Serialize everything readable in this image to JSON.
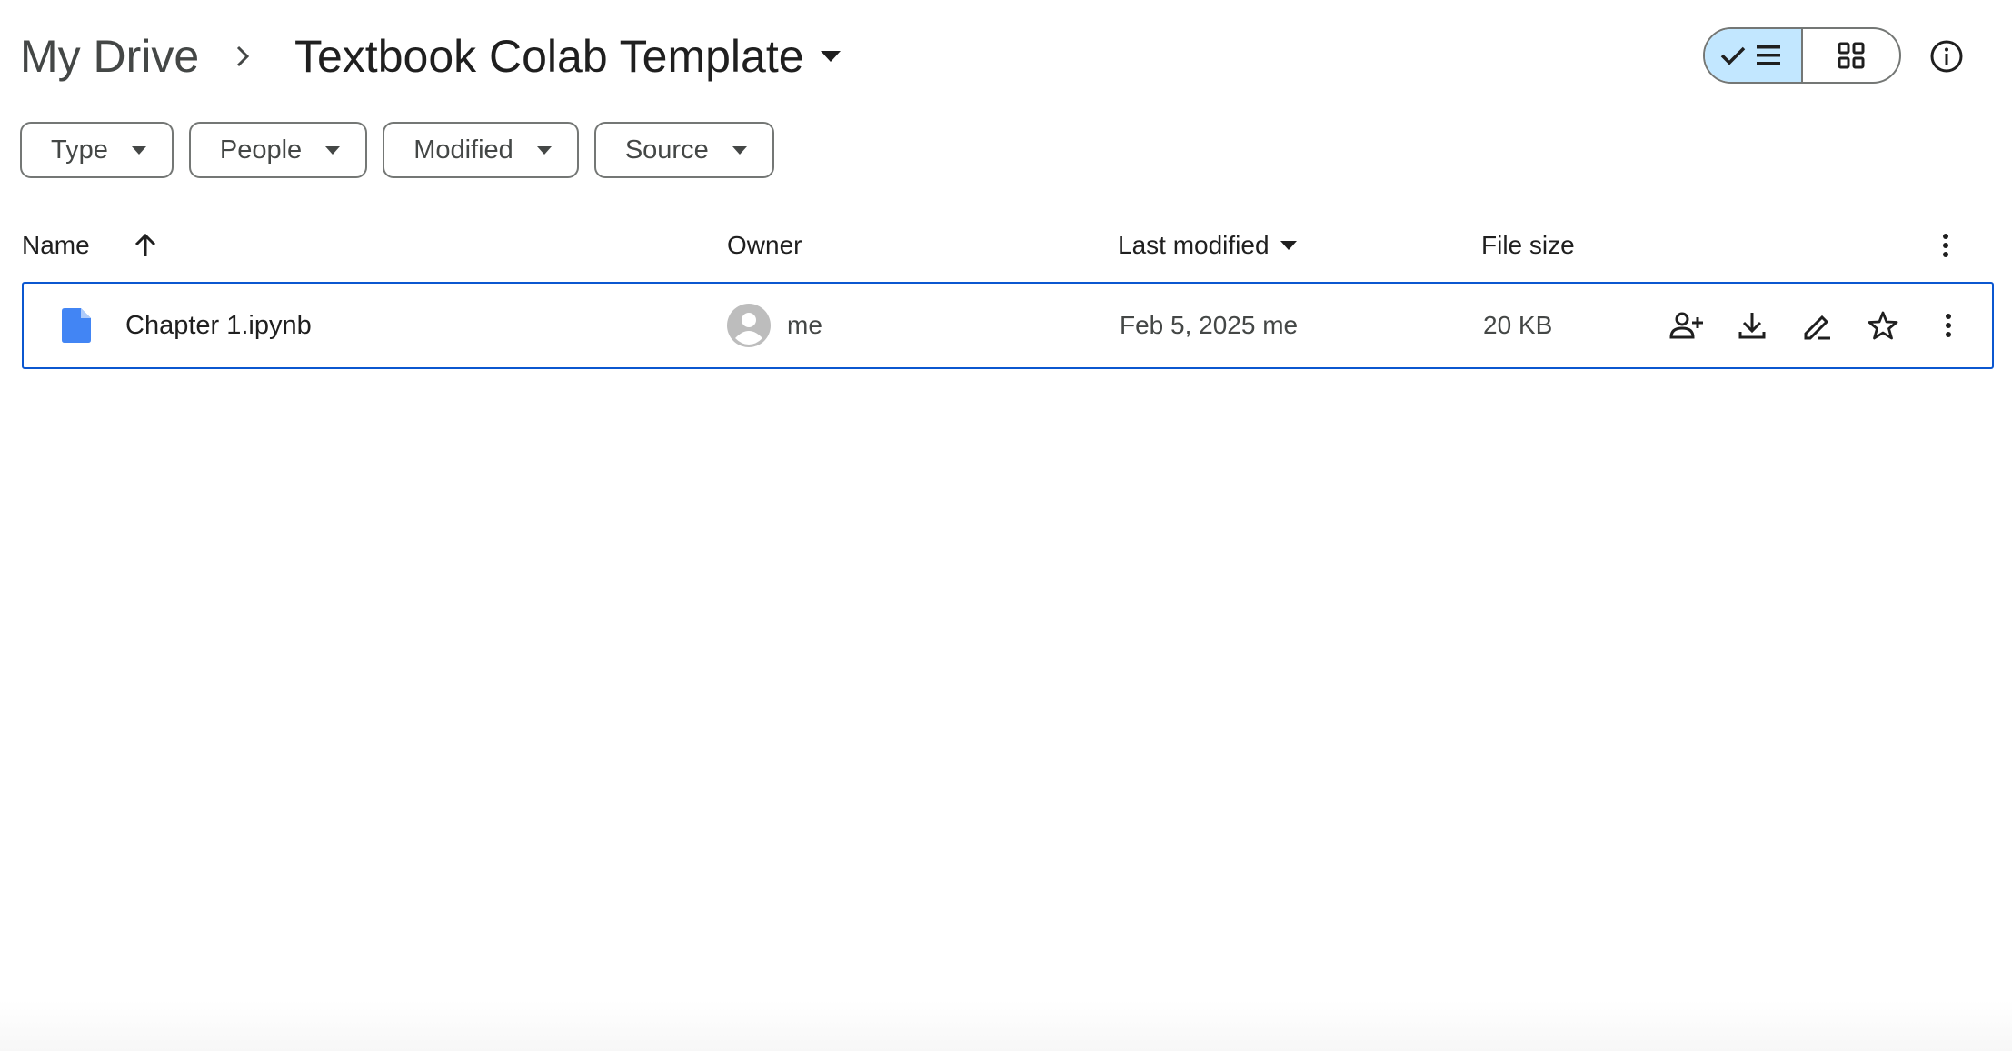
{
  "breadcrumb": {
    "root": "My Drive",
    "current": "Textbook Colab Template"
  },
  "view_toggle": {
    "active": "list",
    "list_icon": "list-icon",
    "grid_icon": "grid-icon"
  },
  "info_icon": "info-icon",
  "filters": [
    {
      "label": "Type"
    },
    {
      "label": "People"
    },
    {
      "label": "Modified"
    },
    {
      "label": "Source"
    }
  ],
  "table": {
    "headers": {
      "name": "Name",
      "owner": "Owner",
      "last_modified": "Last modified",
      "file_size": "File size"
    },
    "sort": {
      "column": "name",
      "direction": "ascending"
    },
    "rows": [
      {
        "name": "Chapter 1.ipynb",
        "file_type_icon": "document-icon",
        "owner": "me",
        "last_modified": "Feb 5, 2025",
        "modified_by": "me",
        "file_size": "20 KB",
        "selected": true
      }
    ]
  },
  "colors": {
    "accent": "#0b57d0",
    "toggle_active": "#c2e7ff",
    "file_icon": "#4285f4"
  }
}
